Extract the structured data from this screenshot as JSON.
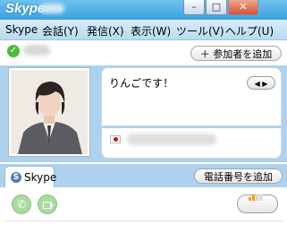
{
  "window": {
    "app_name": "Skype"
  },
  "window_buttons": {
    "minimize": "–",
    "maximize": "□",
    "close": "✕"
  },
  "menu": [
    {
      "label": "Skype"
    },
    {
      "label": "会話(Y)"
    },
    {
      "label": "発信(X)"
    },
    {
      "label": "表示(W)"
    },
    {
      "label": "ツール(V)"
    },
    {
      "label": "ヘルプ(U)"
    }
  ],
  "toolbar": {
    "add_participant": "＋ 参加者を追加"
  },
  "conversation": {
    "message": "りんごです！",
    "nav_arrows": "◀ ▶",
    "country_flag": "jp-flag"
  },
  "tabs": [
    {
      "label": "Skype"
    }
  ],
  "actions": {
    "add_phone": "電話番号を追加",
    "call_icon": "phone-icon",
    "video_icon": "video-icon"
  },
  "colors": {
    "accent": "#3aa0de",
    "panel": "#aed1ee",
    "green": "#a9dba1",
    "signal": "#ff9d00"
  }
}
